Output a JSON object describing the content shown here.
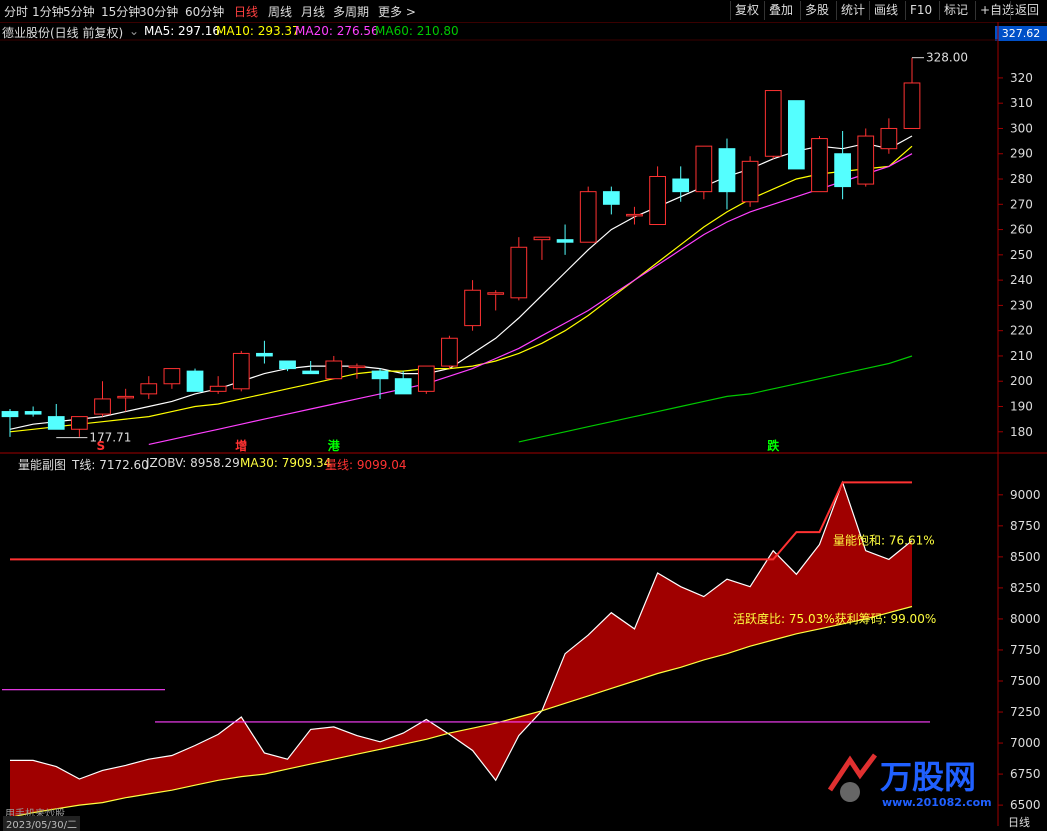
{
  "toolbar": {
    "left_items": [
      "分时",
      "1分钟",
      "5分钟",
      "15分钟",
      "30分钟",
      "60分钟",
      "日线",
      "周线",
      "月线",
      "多周期",
      "更多 >"
    ],
    "active_item": "日线",
    "right_items": [
      "复权",
      "叠加",
      "多股",
      "统计",
      "画线",
      "F10",
      "标记",
      "+自选",
      "返回"
    ]
  },
  "main_info": {
    "stock_name": "德业股份(日线 前复权)",
    "ma5_label": "MA5: 297.16",
    "ma10_label": "MA10: 293.37",
    "ma20_label": "MA20: 276.56",
    "ma60_label": "MA60: 210.80",
    "price_tag": "327.62",
    "high_annotation": "328.00",
    "low_annotation": "177.71",
    "colors": {
      "ma5": "#ffffff",
      "ma10": "#ffff00",
      "ma20": "#ff40ff",
      "ma60": "#00c800",
      "up": "#ff3232",
      "down": "#54ffff"
    }
  },
  "sub_info": {
    "title": "量能副图",
    "t_line": "T线: 7172.60",
    "jzobv": "JZOBV: 8958.29",
    "ma30": "MA30: 7909.34",
    "volume_line": "量线: 9099.04",
    "saturation": "量能饱和: 76.61%",
    "activity": "活跃度比: 75.03%获利筹码: 99.00%"
  },
  "signals": [
    {
      "label": "S",
      "color": "#ff3232",
      "index": 4
    },
    {
      "label": "增",
      "color": "#ff3232",
      "index": 10
    },
    {
      "label": "港",
      "color": "#00ff00",
      "index": 14
    },
    {
      "label": "跌",
      "color": "#00ff00",
      "index": 33
    }
  ],
  "footer": {
    "date": "2023/05/30/二",
    "axis_corner": "日线",
    "watermark_sub": "用手机来炒股"
  },
  "watermark": {
    "text": "万股网",
    "url": "www.201082.com"
  },
  "chart_data": [
    {
      "type": "candlestick",
      "title": "德业股份(日线 前复权)",
      "ylim": [
        172,
        335
      ],
      "yticks": [
        180,
        190,
        200,
        210,
        220,
        230,
        240,
        250,
        260,
        270,
        280,
        290,
        300,
        310,
        320
      ],
      "candles": [
        {
          "o": 188,
          "h": 189,
          "l": 178,
          "c": 186
        },
        {
          "o": 188,
          "h": 190,
          "l": 186,
          "c": 187
        },
        {
          "o": 186,
          "h": 191,
          "l": 181,
          "c": 181
        },
        {
          "o": 181,
          "h": 186,
          "l": 178,
          "c": 186
        },
        {
          "o": 187,
          "h": 200,
          "l": 186,
          "c": 193
        },
        {
          "o": 194,
          "h": 197,
          "l": 188,
          "c": 194
        },
        {
          "o": 195,
          "h": 202,
          "l": 193,
          "c": 199
        },
        {
          "o": 199,
          "h": 205,
          "l": 197,
          "c": 205
        },
        {
          "o": 204,
          "h": 205,
          "l": 196,
          "c": 196
        },
        {
          "o": 196,
          "h": 202,
          "l": 195,
          "c": 198
        },
        {
          "o": 197,
          "h": 212,
          "l": 196,
          "c": 211
        },
        {
          "o": 211,
          "h": 216,
          "l": 207,
          "c": 210
        },
        {
          "o": 208,
          "h": 208,
          "l": 204,
          "c": 205
        },
        {
          "o": 204,
          "h": 208,
          "l": 203,
          "c": 203
        },
        {
          "o": 201,
          "h": 210,
          "l": 201,
          "c": 208
        },
        {
          "o": 206,
          "h": 207,
          "l": 201,
          "c": 206
        },
        {
          "o": 204,
          "h": 205,
          "l": 193,
          "c": 201
        },
        {
          "o": 201,
          "h": 204,
          "l": 195,
          "c": 195
        },
        {
          "o": 196,
          "h": 206,
          "l": 195,
          "c": 206
        },
        {
          "o": 206,
          "h": 218,
          "l": 205,
          "c": 217
        },
        {
          "o": 222,
          "h": 240,
          "l": 220,
          "c": 236
        },
        {
          "o": 235,
          "h": 236,
          "l": 228,
          "c": 235
        },
        {
          "o": 233,
          "h": 257,
          "l": 232,
          "c": 253
        },
        {
          "o": 256,
          "h": 257,
          "l": 248,
          "c": 257
        },
        {
          "o": 256,
          "h": 262,
          "l": 250,
          "c": 255
        },
        {
          "o": 255,
          "h": 277,
          "l": 255,
          "c": 275
        },
        {
          "o": 275,
          "h": 277,
          "l": 266,
          "c": 270
        },
        {
          "o": 266,
          "h": 269,
          "l": 262,
          "c": 266
        },
        {
          "o": 262,
          "h": 285,
          "l": 262,
          "c": 281
        },
        {
          "o": 280,
          "h": 285,
          "l": 271,
          "c": 275
        },
        {
          "o": 275,
          "h": 292,
          "l": 272,
          "c": 293
        },
        {
          "o": 292,
          "h": 296,
          "l": 268,
          "c": 275
        },
        {
          "o": 271,
          "h": 289,
          "l": 269,
          "c": 287
        },
        {
          "o": 289,
          "h": 315,
          "l": 288,
          "c": 315
        },
        {
          "o": 311,
          "h": 311,
          "l": 284,
          "c": 284
        },
        {
          "o": 275,
          "h": 297,
          "l": 275,
          "c": 296
        },
        {
          "o": 290,
          "h": 299,
          "l": 272,
          "c": 277
        },
        {
          "o": 278,
          "h": 300,
          "l": 277,
          "c": 297
        },
        {
          "o": 292,
          "h": 304,
          "l": 290,
          "c": 300
        },
        {
          "o": 300,
          "h": 328,
          "l": 300,
          "c": 318
        }
      ],
      "series": [
        {
          "name": "MA5",
          "values": [
            181,
            183,
            184,
            185,
            186,
            188,
            190,
            192,
            195,
            197,
            200,
            203,
            205,
            206,
            206,
            206,
            205,
            203,
            203,
            205,
            211,
            217,
            225,
            234,
            243,
            252,
            260,
            265,
            269,
            273,
            277,
            281,
            284,
            288,
            291,
            293,
            292,
            294,
            292,
            297
          ]
        },
        {
          "name": "MA10",
          "values": [
            180,
            181,
            182,
            183,
            184,
            185,
            186,
            188,
            190,
            191,
            193,
            195,
            197,
            199,
            201,
            203,
            204,
            204,
            205,
            205,
            206,
            208,
            211,
            215,
            220,
            226,
            233,
            240,
            247,
            254,
            261,
            267,
            272,
            276,
            280,
            282,
            283,
            284,
            285,
            293
          ]
        },
        {
          "name": "MA20",
          "values": [
            null,
            null,
            null,
            null,
            null,
            null,
            175,
            177,
            179,
            181,
            183,
            185,
            187,
            189,
            191,
            193,
            195,
            197,
            199,
            202,
            205,
            209,
            213,
            218,
            223,
            228,
            234,
            240,
            246,
            252,
            258,
            263,
            267,
            270,
            273,
            276,
            279,
            282,
            285,
            290
          ]
        },
        {
          "name": "MA60",
          "values": [
            null,
            null,
            null,
            null,
            null,
            null,
            null,
            null,
            null,
            null,
            null,
            null,
            null,
            null,
            null,
            null,
            null,
            null,
            null,
            null,
            null,
            null,
            176,
            178,
            180,
            182,
            184,
            186,
            188,
            190,
            192,
            194,
            195,
            197,
            199,
            201,
            203,
            205,
            207,
            210
          ]
        }
      ]
    },
    {
      "type": "area",
      "title": "量能副图",
      "ylim": [
        6380,
        9200
      ],
      "yticks": [
        6500,
        6750,
        7000,
        7250,
        7500,
        7750,
        8000,
        8250,
        8500,
        8750,
        9000
      ],
      "series": [
        {
          "name": "量线",
          "values": [
            6860,
            6860,
            6810,
            6710,
            6780,
            6820,
            6870,
            6900,
            6980,
            7070,
            7210,
            6920,
            6870,
            7110,
            7130,
            7060,
            7010,
            7080,
            7190,
            7070,
            6940,
            6700,
            7060,
            7260,
            7720,
            7870,
            8050,
            7920,
            8370,
            8260,
            8180,
            8320,
            8260,
            8550,
            8360,
            8600,
            9100,
            8550,
            8480,
            8630
          ]
        },
        {
          "name": "MA30",
          "values": [
            6400,
            6440,
            6470,
            6500,
            6520,
            6560,
            6590,
            6620,
            6660,
            6700,
            6730,
            6750,
            6790,
            6830,
            6870,
            6910,
            6950,
            6990,
            7030,
            7080,
            7120,
            7160,
            7210,
            7260,
            7320,
            7380,
            7440,
            7500,
            7560,
            7610,
            7670,
            7720,
            7780,
            7830,
            7880,
            7920,
            7960,
            8000,
            8050,
            8100
          ]
        },
        {
          "name": "T线",
          "values": [
            8480,
            8480,
            8480,
            8480,
            8480,
            8480,
            8480,
            8480,
            8480,
            8480,
            8480,
            8480,
            8480,
            8480,
            8480,
            8480,
            8480,
            8480,
            8480,
            8480,
            8480,
            8480,
            8480,
            8480,
            8480,
            8480,
            8480,
            8480,
            8480,
            8480,
            8480,
            8480,
            8480,
            8480,
            8700,
            8700,
            9100,
            9100,
            9100,
            9100
          ]
        }
      ]
    }
  ]
}
